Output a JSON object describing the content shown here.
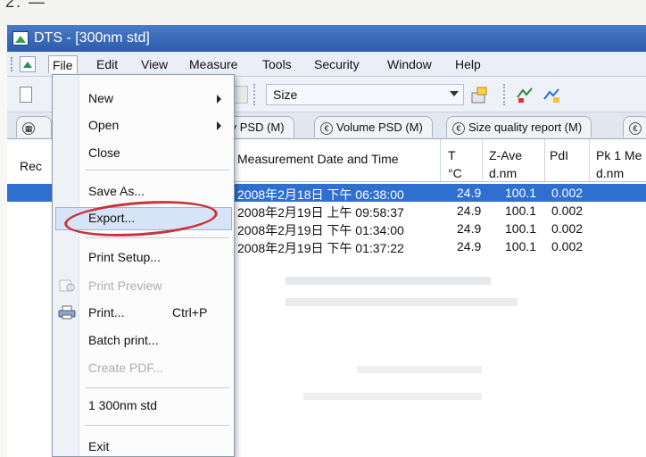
{
  "window": {
    "title": "DTS - [300nm std]"
  },
  "menubar": {
    "items": [
      "File",
      "Edit",
      "View",
      "Measure",
      "Tools",
      "Security",
      "Window",
      "Help"
    ]
  },
  "toolbar": {
    "size_label": "Size"
  },
  "tabs": [
    "ty PSD (M)",
    "Volume PSD (M)",
    "Size quality report (M)"
  ],
  "table": {
    "row_header_label": "Rec",
    "columns": [
      {
        "label": "Measurement Date and Time",
        "unit": ""
      },
      {
        "label": "T",
        "unit": "°C"
      },
      {
        "label": "Z-Ave",
        "unit": "d.nm"
      },
      {
        "label": "PdI",
        "unit": ""
      },
      {
        "label": "Pk 1 Me",
        "unit": "d.nm"
      }
    ],
    "rows": [
      {
        "date": "2008年2月18日 下午 06:38:00",
        "t": "24.9",
        "zave": "100.1",
        "pdi": "0.002",
        "selected": true
      },
      {
        "date": "2008年2月19日 上午 09:58:37",
        "t": "24.9",
        "zave": "100.1",
        "pdi": "0.002",
        "selected": false
      },
      {
        "date": "2008年2月19日 下午 01:34:00",
        "t": "24.9",
        "zave": "100.1",
        "pdi": "0.002",
        "selected": false
      },
      {
        "date": "2008年2月19日 下午 01:37:22",
        "t": "24.9",
        "zave": "100.1",
        "pdi": "0.002",
        "selected": false
      }
    ]
  },
  "file_menu": {
    "new": "New",
    "open": "Open",
    "close": "Close",
    "save_as": "Save As...",
    "export": "Export...",
    "print_setup": "Print Setup...",
    "print_preview": "Print Preview",
    "print": "Print...",
    "print_shortcut": "Ctrl+P",
    "batch_print": "Batch print...",
    "create_pdf": "Create PDF...",
    "recent_file": "1 300nm std",
    "exit": "Exit"
  },
  "colors": {
    "title_bar": "#2d5cab",
    "selection": "#2f6fcf",
    "annotation_ellipse": "#c9343b"
  }
}
